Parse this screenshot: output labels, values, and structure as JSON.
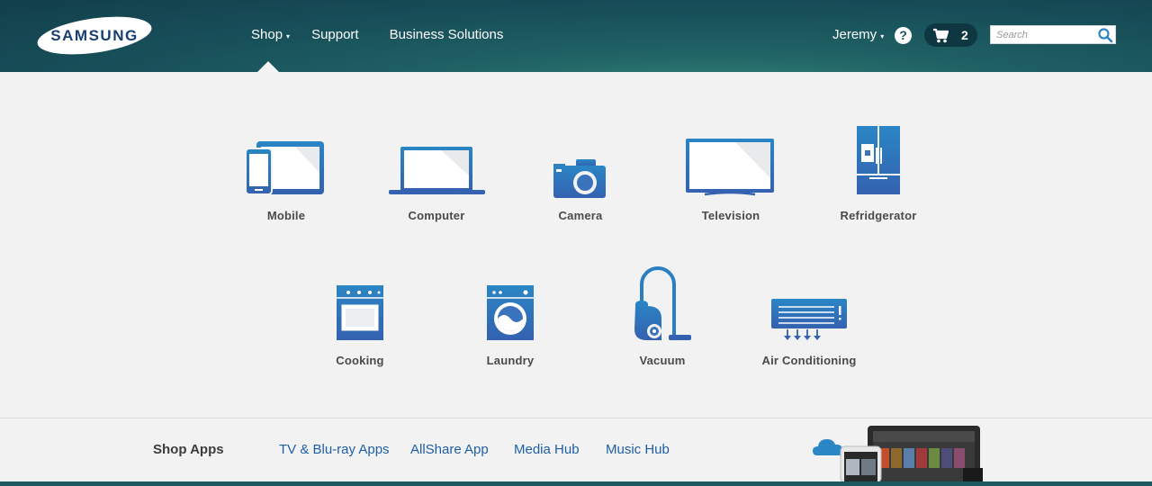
{
  "brand": {
    "logo_text": "SAMSUNG"
  },
  "nav": {
    "items": [
      {
        "label": "Shop",
        "caret": "▾"
      },
      {
        "label": "Support"
      },
      {
        "label": "Business Solutions"
      }
    ]
  },
  "user": {
    "name": "Jeremy",
    "caret": "▾"
  },
  "help": {
    "glyph": "?"
  },
  "cart": {
    "count": "2"
  },
  "search": {
    "placeholder": "Search"
  },
  "categories": [
    {
      "label": "Mobile",
      "icon": "mobile-icon"
    },
    {
      "label": "Computer",
      "icon": "laptop-icon"
    },
    {
      "label": "Camera",
      "icon": "camera-icon"
    },
    {
      "label": "Television",
      "icon": "tv-icon"
    },
    {
      "label": "Refridgerator",
      "icon": "refrigerator-icon"
    },
    {
      "label": "Cooking",
      "icon": "oven-icon"
    },
    {
      "label": "Laundry",
      "icon": "washer-icon"
    },
    {
      "label": "Vacuum",
      "icon": "vacuum-icon"
    },
    {
      "label": "Air Conditioning",
      "icon": "air-conditioner-icon"
    }
  ],
  "shop_apps": {
    "title": "Shop Apps",
    "links": [
      {
        "label": "TV & Blu-ray Apps"
      },
      {
        "label": "AllShare App"
      },
      {
        "label": "Media Hub"
      },
      {
        "label": "Music Hub"
      }
    ]
  },
  "colors": {
    "header_dark": "#123f4c",
    "header_teal": "#2f7e74",
    "icon_blue_top": "#2a86c4",
    "icon_blue_bottom": "#3461b0",
    "link_blue": "#1e5fa5"
  }
}
